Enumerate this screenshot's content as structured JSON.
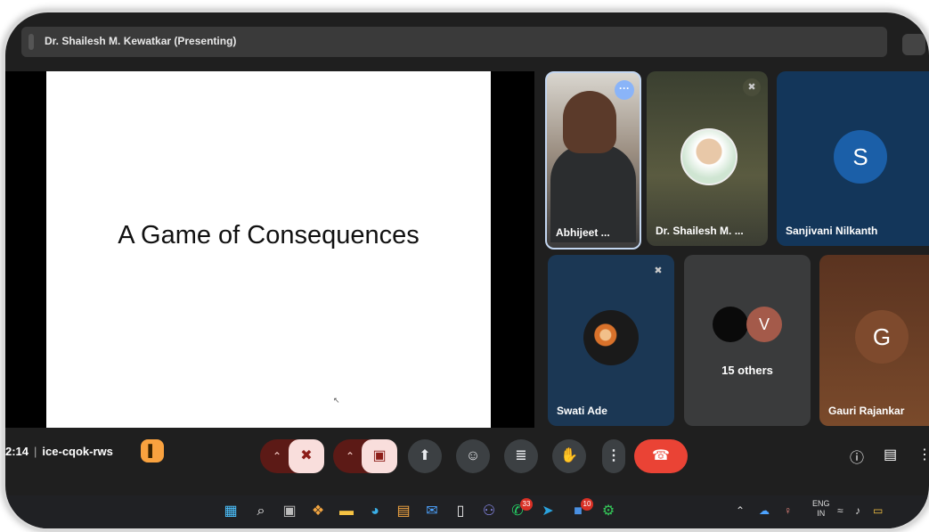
{
  "presenter_bar": {
    "title": "Dr. Shailesh M. Kewatkar (Presenting)"
  },
  "slide": {
    "title": "A Game of Consequences"
  },
  "participants": [
    {
      "name": "Abhijeet ...",
      "muted": false,
      "tile": "video",
      "menu_icon": "more-horizontal-icon"
    },
    {
      "name": "Dr. Shailesh M. ...",
      "muted": true,
      "tile": "photo"
    },
    {
      "name": "Sanjivani Nilkanth",
      "muted": false,
      "tile": "letter",
      "letter": "S",
      "color": "#1b5fa8"
    },
    {
      "name": "Swati Ade",
      "muted": true,
      "tile": "photo"
    },
    {
      "name": "15 others",
      "tile": "group",
      "letter": "V",
      "color": "#a45a4a"
    },
    {
      "name": "Gauri Rajankar",
      "muted": false,
      "tile": "letter",
      "letter": "G",
      "color": "#7e4a2d"
    }
  ],
  "toolbar": {
    "time": "2:14",
    "separator": "|",
    "meeting_code": "ice-cqok-rws",
    "icons": {
      "room": "door-icon",
      "mic": "mic-off-icon",
      "camera": "camera-off-icon",
      "present": "present-screen-icon",
      "emoji": "emoji-icon",
      "captions": "captions-icon",
      "hand": "raise-hand-icon",
      "more": "more-vert-icon",
      "leave": "call-end-icon",
      "info": "info-icon",
      "chat": "chat-icon"
    }
  },
  "taskbar": {
    "badges": {
      "whatsapp": "33",
      "linkedin": "10"
    },
    "lang": {
      "line1": "ENG",
      "line2": "IN"
    }
  },
  "colors": {
    "leave": "#ea4335",
    "mic_off_bg": "#f9dedc",
    "accent_blue": "#8ab4f8"
  }
}
